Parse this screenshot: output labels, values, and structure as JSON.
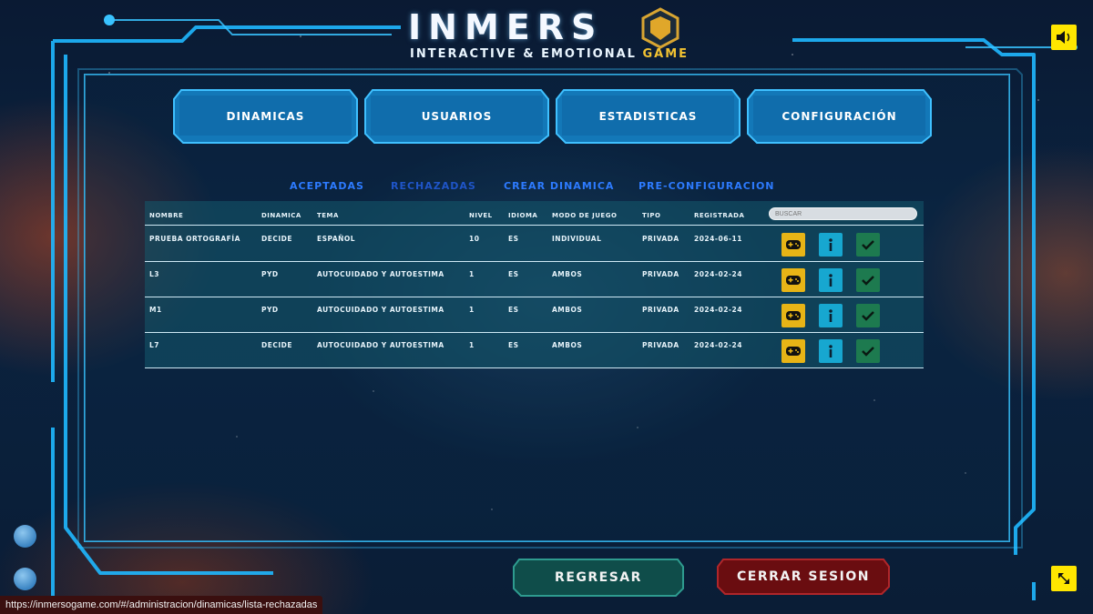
{
  "header": {
    "logo_word": "INMERS",
    "logo_sub_main": "INTERACTIVE & EMOTIONAL ",
    "logo_sub_accent": "GAME"
  },
  "colors": {
    "accent_cyan": "#1fb8ff",
    "play_button": "#e7b416",
    "info_button": "#17a7d0",
    "accept_button": "#1d7a4f",
    "logout_red": "#7a0f12",
    "back_teal": "#0f4d4a"
  },
  "nav": {
    "items": [
      {
        "label": "DINAMICAS"
      },
      {
        "label": "USUARIOS"
      },
      {
        "label": "ESTADISTICAS"
      },
      {
        "label": "CONFIGURACIÓN"
      }
    ]
  },
  "subtabs": {
    "items": [
      {
        "label": "ACEPTADAS"
      },
      {
        "label": "RECHAZADAS"
      },
      {
        "label": "CREAR DINAMICA"
      },
      {
        "label": "PRE-CONFIGURACION"
      }
    ],
    "active": "RECHAZADAS"
  },
  "table": {
    "columns": [
      "NOMBRE",
      "DINAMICA",
      "TEMA",
      "NIVEL",
      "IDIOMA",
      "MODO DE JUEGO",
      "TIPO",
      "REGISTRADA"
    ],
    "search_placeholder": "BUSCAR",
    "rows": [
      {
        "cells": [
          "PRUEBA ORTOGRAFÍA",
          "DECIDE",
          "ESPAÑOL",
          "10",
          "ES",
          "INDIVIDUAL",
          "PRIVADA",
          "2024-06-11"
        ]
      },
      {
        "cells": [
          "L3",
          "PYD",
          "AUTOCUIDADO Y AUTOESTIMA",
          "1",
          "ES",
          "AMBOS",
          "PRIVADA",
          "2024-02-24"
        ]
      },
      {
        "cells": [
          "M1",
          "PYD",
          "AUTOCUIDADO Y AUTOESTIMA",
          "1",
          "ES",
          "AMBOS",
          "PRIVADA",
          "2024-02-24"
        ]
      },
      {
        "cells": [
          "L7",
          "DECIDE",
          "AUTOCUIDADO Y AUTOESTIMA",
          "1",
          "ES",
          "AMBOS",
          "PRIVADA",
          "2024-02-24"
        ]
      }
    ],
    "row_actions": [
      "gamepad-icon",
      "info-icon",
      "check-icon"
    ]
  },
  "footer": {
    "back_label": "REGRESAR",
    "logout_label": "CERRAR SESION"
  },
  "controls": {
    "sound_icon": "speaker-icon",
    "fullscreen_icon": "expand-icon"
  },
  "status_url": "https://inmersogame.com/#/administracion/dinamicas/lista-rechazadas"
}
